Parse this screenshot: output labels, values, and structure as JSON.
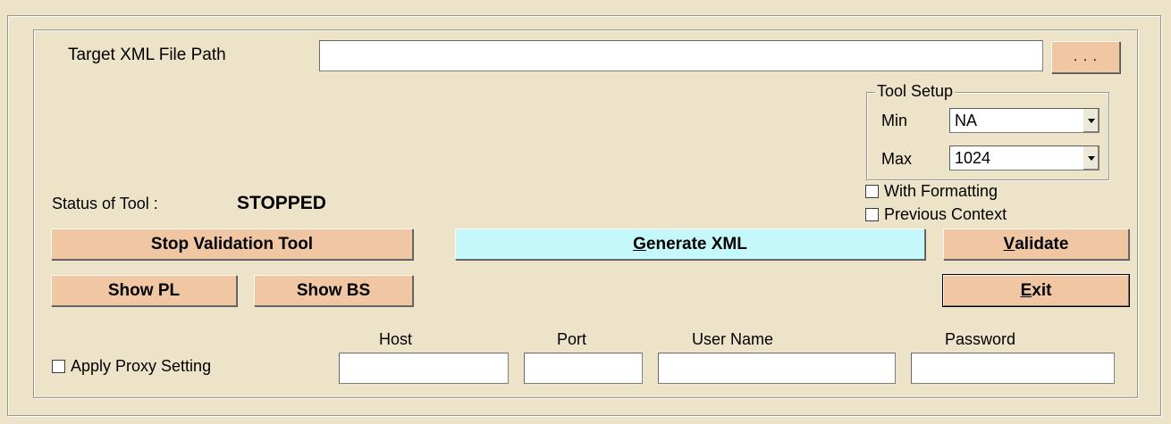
{
  "target": {
    "label": "Target XML File Path",
    "path_value": "",
    "browse_label": ". . ."
  },
  "tool_setup": {
    "legend": "Tool Setup",
    "min_label": "Min",
    "min_value": "NA",
    "max_label": "Max",
    "max_value": "1024"
  },
  "options": {
    "with_formatting": "With Formatting",
    "previous_context": "Previous Context"
  },
  "status": {
    "label": "Status of Tool :",
    "value": "STOPPED"
  },
  "buttons": {
    "stop_validation": "Stop Validation Tool",
    "generate_xml_u": "G",
    "generate_xml_rest": "enerate XML",
    "validate_u": "V",
    "validate_rest": "alidate",
    "show_pl": "Show PL",
    "show_bs": "Show BS",
    "exit_u": "E",
    "exit_rest": "xit"
  },
  "proxy": {
    "apply_label": "Apply Proxy Setting",
    "host_label": "Host",
    "port_label": "Port",
    "user_label": "User Name",
    "password_label": "Password",
    "host_value": "",
    "port_value": "",
    "user_value": "",
    "password_value": ""
  },
  "colors": {
    "background": "#ece3c9",
    "button": "#f0c7a2",
    "button_highlight": "#c4f8fb"
  }
}
